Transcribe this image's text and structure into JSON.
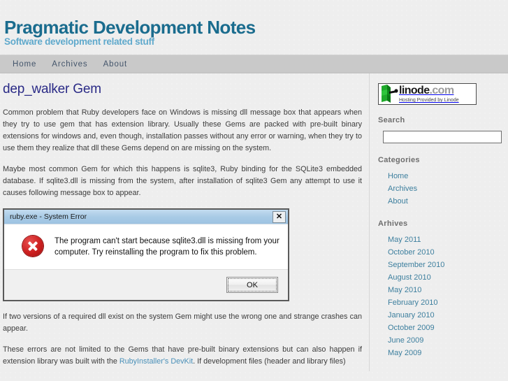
{
  "site": {
    "title": "Pragmatic Development Notes",
    "tagline": "Software development related stuff"
  },
  "nav": {
    "items": [
      {
        "label": "Home"
      },
      {
        "label": "Archives"
      },
      {
        "label": "About"
      }
    ]
  },
  "post": {
    "title": "dep_walker Gem",
    "paragraph1": "Common problem that Ruby developers face on Windows is missing dll message box that appears when they try to use gem that has extension library. Usually these Gems are packed with pre-built binary extensions for windows and, even though, installation passes without any error or warning, when they try to use them they realize that dll these Gems depend on are missing on the system.",
    "paragraph2": "Maybe most common Gem for which this happens is sqlite3, Ruby binding for the SQLite3 embedded database. If sqlite3.dll is missing from the system, after installation of sqlite3 Gem any attempt to use it causes following message box to appear.",
    "paragraph3": "If two versions of a required dll exist on the system Gem might use the wrong one and strange crashes can appear.",
    "paragraph4_part1": "These errors are not limited to the Gems that have pre-built binary extensions but can also happen if extension library was built with the ",
    "paragraph4_link": "RubyInstaller's DevKit",
    "paragraph4_part2": ". If development files (header and library files)"
  },
  "error_dialog": {
    "title": "ruby.exe - System Error",
    "close_label": "✕",
    "message": "The program can't start because sqlite3.dll is missing from your computer. Try reinstalling the program to fix this problem.",
    "ok_label": "OK",
    "icon": "error-cross-icon"
  },
  "sidebar": {
    "banner": {
      "wordmark": "linode",
      "wordmark_suffix": ".com",
      "tagline": "Hosting Provided by Linode"
    },
    "search": {
      "heading": "Search",
      "value": "",
      "placeholder": ""
    },
    "categories": {
      "heading": "Categories",
      "items": [
        {
          "label": "Home"
        },
        {
          "label": "Archives"
        },
        {
          "label": "About"
        }
      ]
    },
    "archives": {
      "heading": "Arhives",
      "items": [
        {
          "label": "May 2011"
        },
        {
          "label": "October 2010"
        },
        {
          "label": "September 2010"
        },
        {
          "label": "August 2010"
        },
        {
          "label": "May 2010"
        },
        {
          "label": "February 2010"
        },
        {
          "label": "January 2010"
        },
        {
          "label": "October 2009"
        },
        {
          "label": "June 2009"
        },
        {
          "label": "May 2009"
        }
      ]
    }
  },
  "colors": {
    "site_title": "#1a6c8e",
    "site_tagline": "#5fa9cc",
    "post_title": "#2a2a86",
    "link": "#3d7f9e",
    "nav_bg": "#c9c9c9",
    "page_bg": "#eeeeee",
    "error_red": "#cc1f1f"
  }
}
